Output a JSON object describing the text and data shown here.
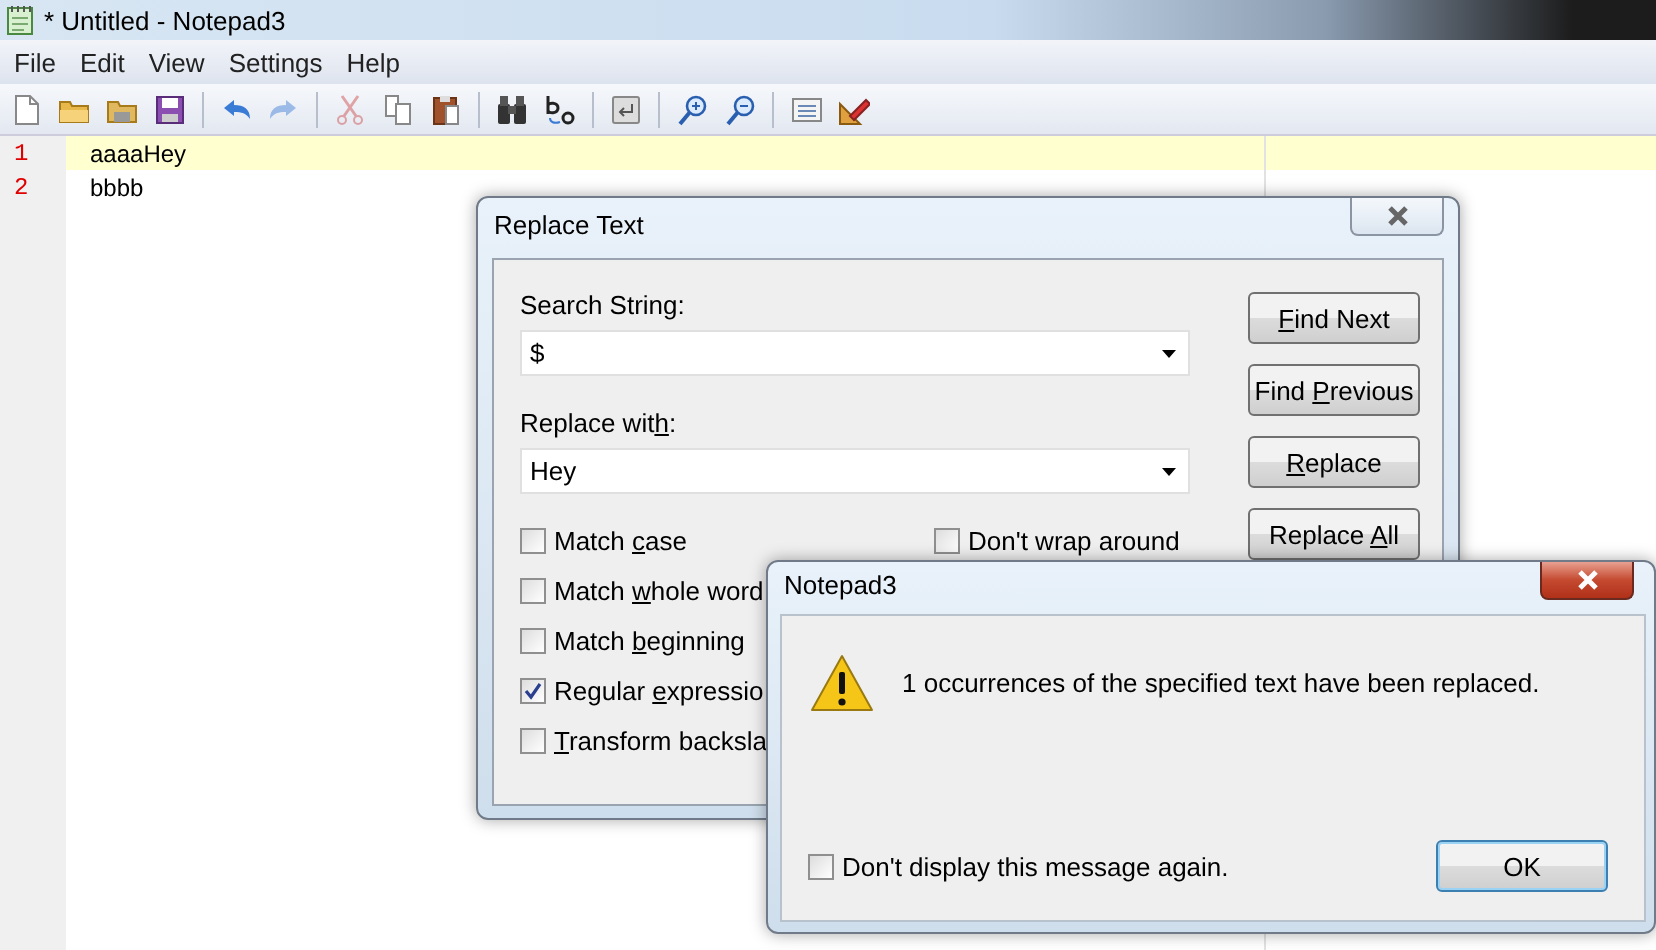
{
  "window": {
    "title": "* Untitled - Notepad3"
  },
  "menu": [
    "File",
    "Edit",
    "View",
    "Settings",
    "Help"
  ],
  "toolbar": [
    {
      "kind": "new",
      "disabled": false
    },
    {
      "kind": "open",
      "disabled": false
    },
    {
      "kind": "browse",
      "disabled": false
    },
    {
      "kind": "save",
      "disabled": false
    },
    {
      "kind": "separator"
    },
    {
      "kind": "undo",
      "disabled": false
    },
    {
      "kind": "redo",
      "disabled": true
    },
    {
      "kind": "separator"
    },
    {
      "kind": "cut",
      "disabled": true
    },
    {
      "kind": "copy",
      "disabled": false
    },
    {
      "kind": "paste",
      "disabled": false
    },
    {
      "kind": "separator"
    },
    {
      "kind": "find",
      "disabled": false
    },
    {
      "kind": "replace",
      "disabled": false
    },
    {
      "kind": "separator"
    },
    {
      "kind": "wrap",
      "disabled": false
    },
    {
      "kind": "separator"
    },
    {
      "kind": "zoom-in",
      "disabled": false
    },
    {
      "kind": "zoom-out",
      "disabled": false
    },
    {
      "kind": "separator"
    },
    {
      "kind": "schemes",
      "disabled": false
    },
    {
      "kind": "customize",
      "disabled": false
    }
  ],
  "editor": {
    "lines": [
      {
        "number": "1",
        "text": "aaaaHey",
        "current": true
      },
      {
        "number": "2",
        "text": "bbbb",
        "current": false
      }
    ]
  },
  "replace_dialog": {
    "title": "Replace Text",
    "search_label": {
      "before": "Search Strin",
      "key": "g",
      "after": ":"
    },
    "search_value": "$",
    "replace_label": {
      "before": "Replace wit",
      "key": "h",
      "after": ":"
    },
    "replace_value": "Hey",
    "options": [
      {
        "label": {
          "before": "Match ",
          "key": "c",
          "after": "ase"
        },
        "checked": false
      },
      {
        "label": {
          "before": "Match ",
          "key": "w",
          "after": "hole word"
        },
        "checked": false
      },
      {
        "label": {
          "before": "Match ",
          "key": "b",
          "after": "eginning"
        },
        "checked": false
      },
      {
        "label": {
          "before": "Regular ",
          "key": "e",
          "after": "xpressio"
        },
        "checked": true
      },
      {
        "label": {
          "key": "T",
          "after": "ransform backsla"
        },
        "checked": false
      }
    ],
    "options_right": [
      {
        "label": {
          "before": "Don't wrap around"
        },
        "checked": false
      }
    ],
    "buttons": [
      {
        "key": "F",
        "after": "ind Next"
      },
      {
        "before": "Find ",
        "key": "P",
        "after": "revious"
      },
      {
        "key": "R",
        "after": "eplace"
      },
      {
        "before": "Replace ",
        "key": "A",
        "after": "ll"
      }
    ]
  },
  "message_box": {
    "title": "Notepad3",
    "message": "1 occurrences of the specified text have been replaced.",
    "checkbox": {
      "label": "Don't display this message again.",
      "checked": false
    },
    "button": "OK"
  }
}
